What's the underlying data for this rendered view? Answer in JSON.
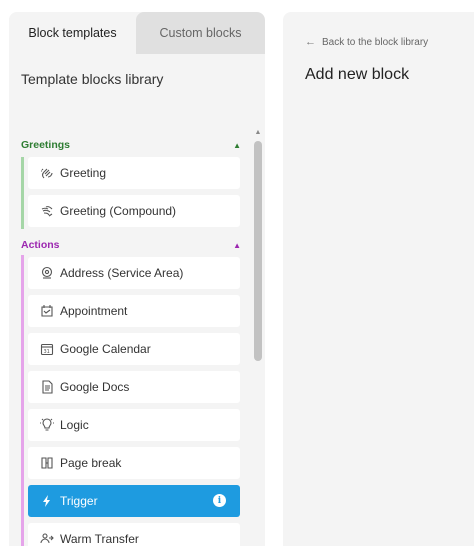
{
  "tabs": [
    {
      "label": "Block templates",
      "active": true
    },
    {
      "label": "Custom blocks",
      "active": false
    }
  ],
  "library": {
    "title": "Template blocks library"
  },
  "sections": {
    "greetings": {
      "label": "Greetings",
      "color": "#2e7d32",
      "bar_color": "#a5d6a7",
      "expanded": true,
      "items": [
        {
          "label": "Greeting",
          "icon": "waving-hand-icon"
        },
        {
          "label": "Greeting (Compound)",
          "icon": "waving-hands-icon"
        }
      ]
    },
    "actions": {
      "label": "Actions",
      "color": "#9c27b0",
      "bar_color": "#e5a4ea",
      "expanded": true,
      "items": [
        {
          "label": "Address (Service Area)",
          "icon": "location-pin-icon"
        },
        {
          "label": "Appointment",
          "icon": "appointment-icon"
        },
        {
          "label": "Google Calendar",
          "icon": "calendar-icon"
        },
        {
          "label": "Google Docs",
          "icon": "document-icon"
        },
        {
          "label": "Logic",
          "icon": "lightbulb-icon"
        },
        {
          "label": "Page break",
          "icon": "page-break-icon"
        },
        {
          "label": "Trigger",
          "icon": "lightning-icon",
          "selected": true
        },
        {
          "label": "Warm Transfer",
          "icon": "transfer-icon"
        }
      ]
    }
  },
  "right_panel": {
    "back_label": "Back to the block library",
    "title": "Add new block"
  },
  "colors": {
    "accent": "#1e9be0",
    "panel_bg": "#f4f4f4"
  }
}
